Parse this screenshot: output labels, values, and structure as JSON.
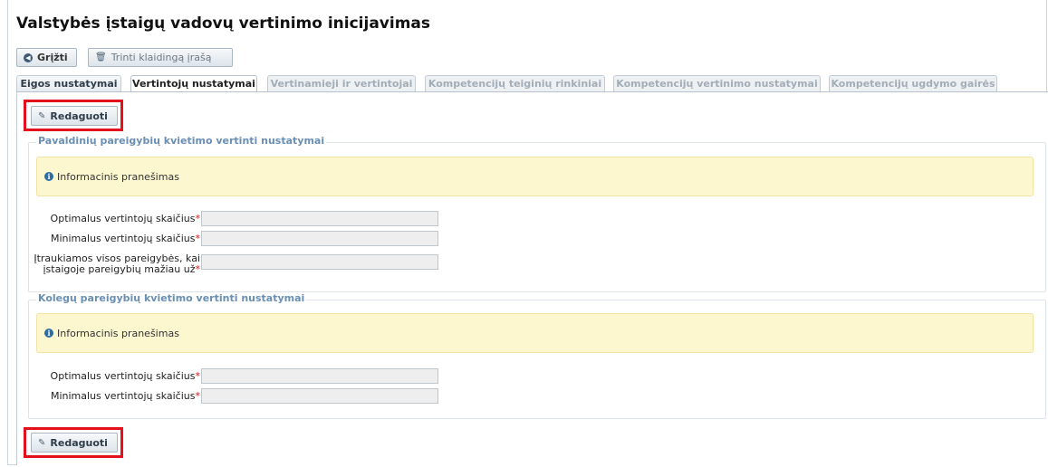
{
  "page": {
    "title": "Valstybės įstaigų vadovų vertinimo inicijavimas"
  },
  "toolbar": {
    "back_label": "Grįžti",
    "back_icon": "arrow-left-circle-icon",
    "delete_label": "Trinti klaidingą įrašą",
    "delete_icon": "trash-icon"
  },
  "tabs": [
    {
      "label": "Eigos nustatymai",
      "state": "enabled"
    },
    {
      "label": "Vertintojų nustatymai",
      "state": "active"
    },
    {
      "label": "Vertinamieji ir vertintojai",
      "state": "disabled"
    },
    {
      "label": "Kompetencijų teiginių rinkiniai",
      "state": "disabled"
    },
    {
      "label": "Kompetencijų vertinimo nustatymai",
      "state": "disabled"
    },
    {
      "label": "Kompetencijų ugdymo gairės",
      "state": "disabled"
    }
  ],
  "edit_button": {
    "label": "Redaguoti",
    "icon": "pencil-icon"
  },
  "highlight_color": "#e3111b",
  "subordinates": {
    "legend": "Pavaldinių pareigybių kvietimo vertinti nustatymai",
    "info": "Informacinis pranešimas",
    "fields": [
      {
        "label": "Optimalus vertintojų skaičius",
        "required_mark": "*",
        "value": ""
      },
      {
        "label": "Minimalus vertintojų skaičius",
        "required_mark": "*",
        "value": ""
      },
      {
        "label_line1": "Įtraukiamos visos pareigybės, kai",
        "label_line2": "įstaigoje pareigybių mažiau už",
        "required_mark": "*",
        "value": ""
      }
    ]
  },
  "colleagues": {
    "legend": "Kolegų pareigybių kvietimo vertinti nustatymai",
    "info": "Informacinis pranešimas",
    "fields": [
      {
        "label": "Optimalus vertintojų skaičius",
        "required_mark": "*",
        "value": ""
      },
      {
        "label": "Minimalus vertintojų skaičius",
        "required_mark": "*",
        "value": ""
      }
    ]
  }
}
